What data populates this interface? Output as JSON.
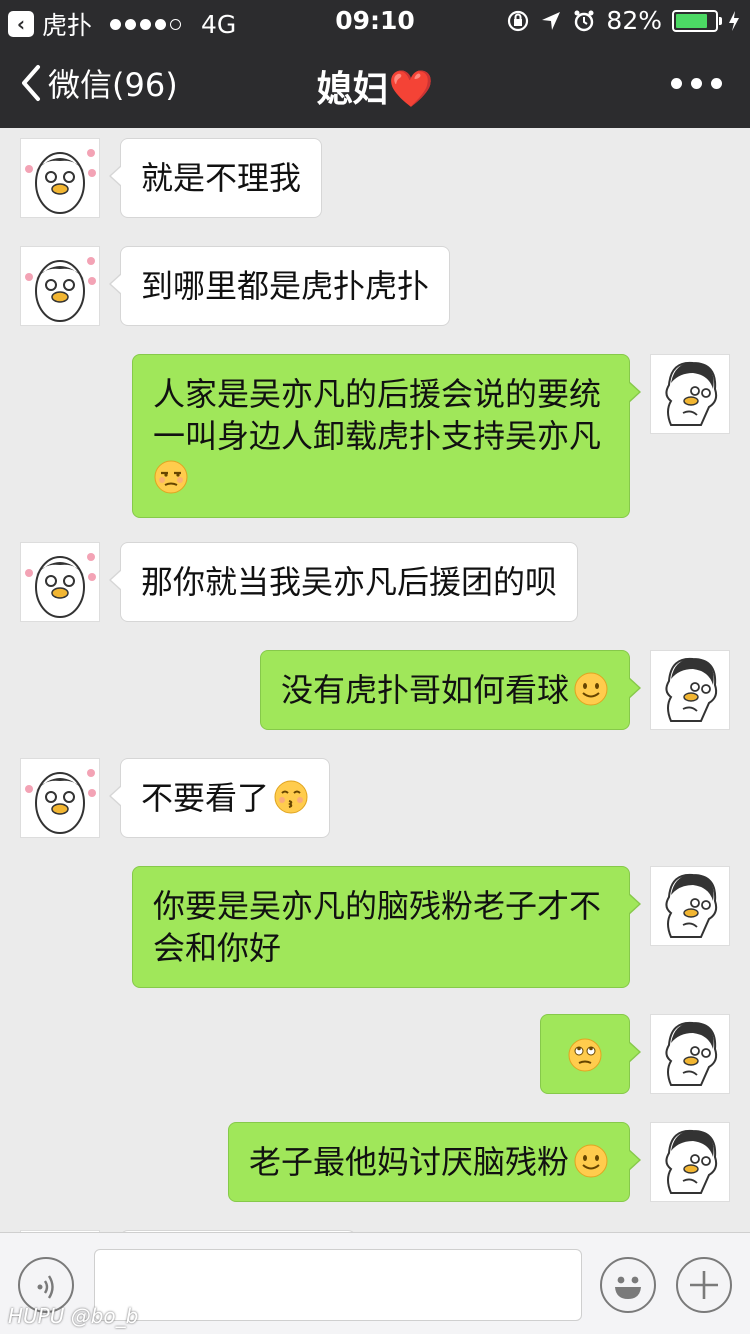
{
  "status_bar": {
    "back_app_label": "虎扑",
    "carrier": "4G",
    "time": "09:10",
    "battery": "82%",
    "battery_level": 0.82,
    "signal_dots_filled": 4
  },
  "nav": {
    "back_label": "微信(96)",
    "title": "媳妇❤️"
  },
  "messages": [
    {
      "side": "in",
      "text": "就是不理我"
    },
    {
      "side": "in",
      "text": "到哪里都是虎扑虎扑"
    },
    {
      "side": "out",
      "text_lines": [
        "人家是吴亦凡的后援会说的要统",
        "一叫身边人卸载虎扑支持吴亦凡"
      ],
      "emoji": "unamused-emoji"
    },
    {
      "side": "in",
      "text": "那你就当我吴亦凡后援团的呗"
    },
    {
      "side": "out",
      "text": "没有虎扑哥如何看球",
      "emoji": "smile-emoji"
    },
    {
      "side": "in",
      "text": "不要看了",
      "emoji": "kissing-emoji"
    },
    {
      "side": "out",
      "text_lines": [
        "你要是吴亦凡的脑残粉老子才不",
        "会和你好"
      ]
    },
    {
      "side": "out",
      "text": "",
      "emoji": "eyeroll-emoji"
    },
    {
      "side": "out",
      "text": "老子最他妈讨厌脑残粉",
      "emoji": "smile-emoji"
    }
  ],
  "watermark": "HUPU @bo_b",
  "colors": {
    "nav_bg": "#2c2c2e",
    "chat_bg": "#ebebeb",
    "out_bubble": "#a0e75a",
    "in_bubble": "#ffffff"
  }
}
